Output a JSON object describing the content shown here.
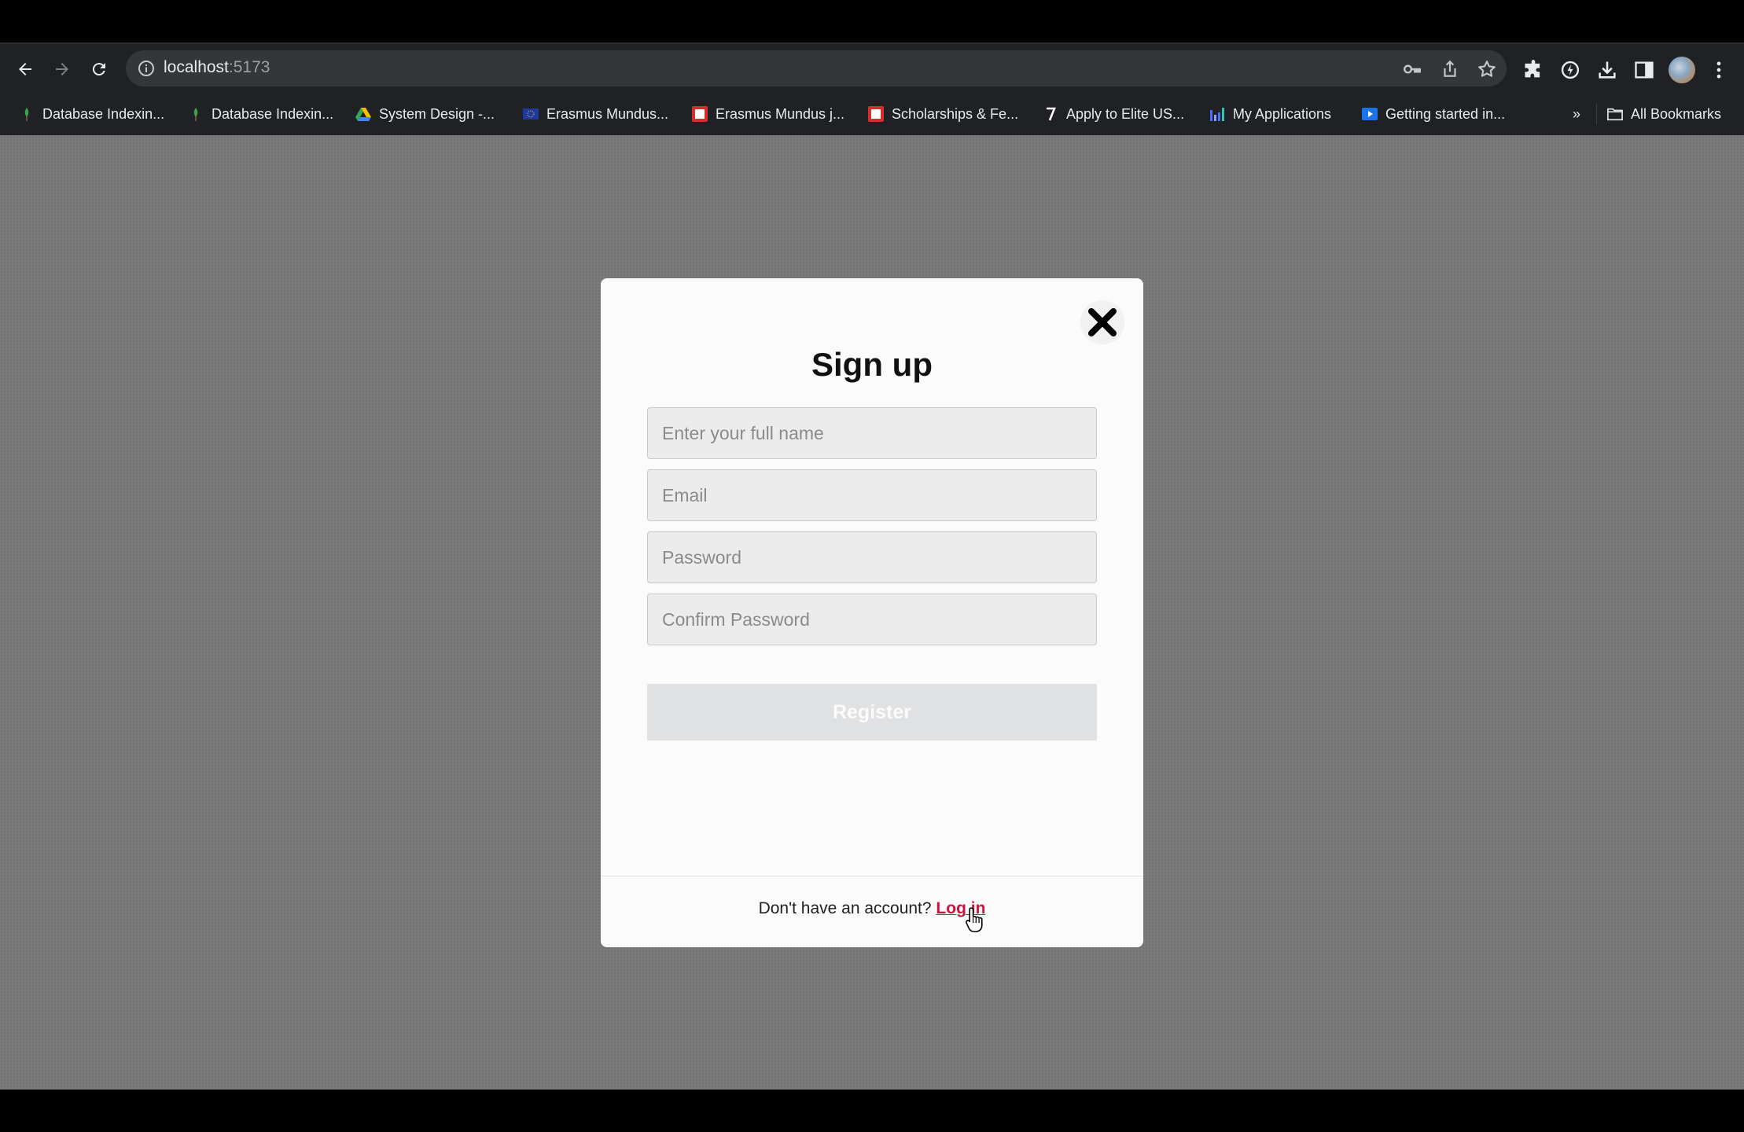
{
  "browser": {
    "url_host": "localhost",
    "url_port": ":5173",
    "bookmarks": [
      {
        "label": "Database Indexin...",
        "icon": "leaf-icon"
      },
      {
        "label": "Database Indexin...",
        "icon": "leaf-icon"
      },
      {
        "label": "System Design -...",
        "icon": "google-drive-icon"
      },
      {
        "label": "Erasmus Mundus...",
        "icon": "eu-flag-icon"
      },
      {
        "label": "Erasmus Mundus j...",
        "icon": "red-square-icon"
      },
      {
        "label": "Scholarships & Fe...",
        "icon": "red-square-icon"
      },
      {
        "label": "Apply to Elite US...",
        "icon": "seven-icon"
      },
      {
        "label": "My Applications",
        "icon": "bar-chart-icon"
      },
      {
        "label": "Getting started in...",
        "icon": "video-icon"
      }
    ],
    "overflow_label": "»",
    "all_bookmarks_label": "All Bookmarks"
  },
  "modal": {
    "title": "Sign up",
    "fields": {
      "full_name_placeholder": "Enter your full name",
      "email_placeholder": "Email",
      "password_placeholder": "Password",
      "confirm_password_placeholder": "Confirm Password"
    },
    "register_label": "Register",
    "footer_text": "Don't have an account?",
    "login_link": "Log in"
  },
  "colors": {
    "link": "#d1123f",
    "overlay": "#7a7a7a",
    "register_disabled_bg": "#e0e1e3"
  }
}
